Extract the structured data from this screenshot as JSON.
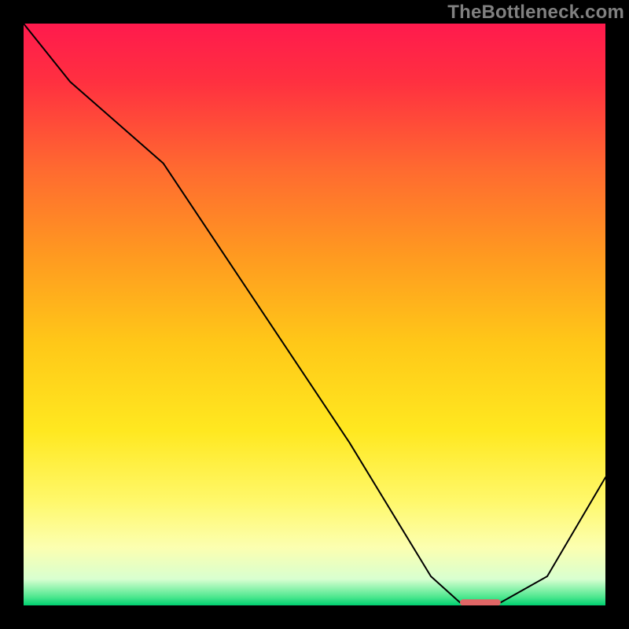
{
  "watermark": "TheBottleneck.com",
  "chart_data": {
    "type": "line",
    "title": "",
    "xlabel": "",
    "ylabel": "",
    "xlim": [
      0,
      100
    ],
    "ylim": [
      0,
      100
    ],
    "x": [
      0,
      8,
      24,
      40,
      56,
      70,
      75,
      82,
      90,
      100
    ],
    "values": [
      100,
      90,
      76,
      52,
      28,
      5,
      0.5,
      0.5,
      5,
      22
    ],
    "marker": {
      "x_start": 75,
      "x_end": 82,
      "y": 0.5,
      "color": "#e06666"
    },
    "gradient_stops": [
      {
        "offset": 0.0,
        "color": "#ff1a4d"
      },
      {
        "offset": 0.1,
        "color": "#ff3040"
      },
      {
        "offset": 0.25,
        "color": "#ff6a30"
      },
      {
        "offset": 0.4,
        "color": "#ff9a20"
      },
      {
        "offset": 0.55,
        "color": "#ffc818"
      },
      {
        "offset": 0.7,
        "color": "#ffe820"
      },
      {
        "offset": 0.82,
        "color": "#fff86a"
      },
      {
        "offset": 0.9,
        "color": "#fcffb0"
      },
      {
        "offset": 0.955,
        "color": "#d8ffd0"
      },
      {
        "offset": 0.985,
        "color": "#50e890"
      },
      {
        "offset": 1.0,
        "color": "#00d070"
      }
    ],
    "line_color": "#000000",
    "line_width": 2.0
  }
}
